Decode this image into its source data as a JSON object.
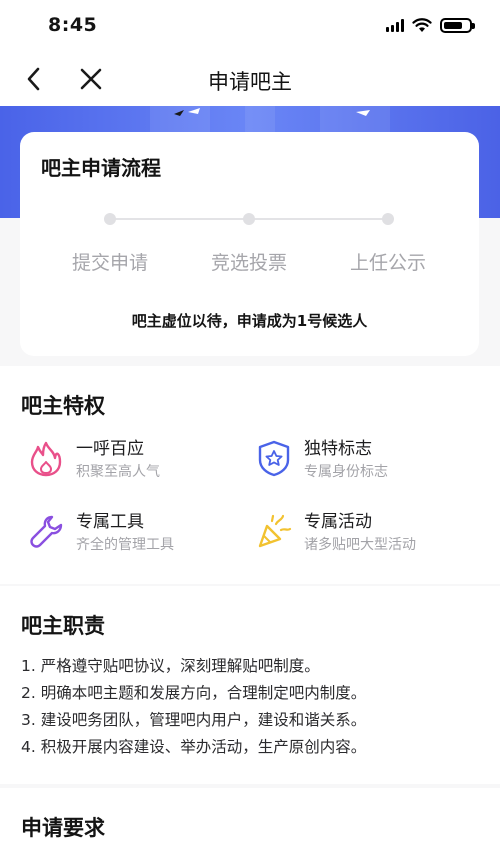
{
  "status_bar": {
    "time": "8:45"
  },
  "nav": {
    "title": "申请吧主"
  },
  "process": {
    "title": "吧主申请流程",
    "steps": [
      "提交申请",
      "竞选投票",
      "上任公示"
    ],
    "note": "吧主虚位以待，申请成为1号候选人"
  },
  "privileges": {
    "title": "吧主特权",
    "items": [
      {
        "name": "一呼百应",
        "desc": "积聚至高人气",
        "icon": "flame-icon",
        "color": "#e9508a"
      },
      {
        "name": "独特标志",
        "desc": "专属身份标志",
        "icon": "star-badge-icon",
        "color": "#4a63e8"
      },
      {
        "name": "专属工具",
        "desc": "齐全的管理工具",
        "icon": "wrench-icon",
        "color": "#8a4fe0"
      },
      {
        "name": "专属活动",
        "desc": "诸多贴吧大型活动",
        "icon": "party-popper-icon",
        "color": "#f2c230"
      }
    ]
  },
  "duties": {
    "title": "吧主职责",
    "lines": [
      "1. 严格遵守贴吧协议，深刻理解贴吧制度。",
      "2. 明确本吧主题和发展方向，合理制定吧内制度。",
      "3. 建设吧务团队，管理吧内用户，建设和谐关系。",
      "4. 积极开展内容建设、举办活动，生产原创内容。"
    ]
  },
  "requirements": {
    "title": "申请要求"
  }
}
